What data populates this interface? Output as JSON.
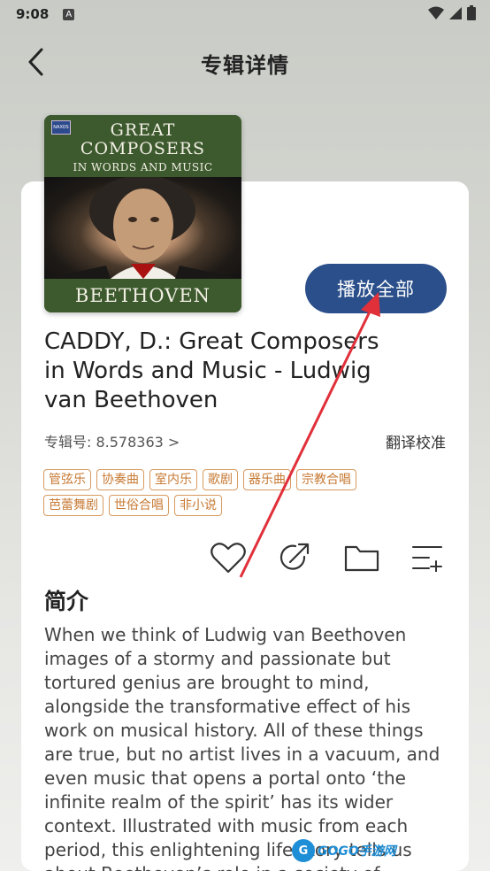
{
  "status_bar": {
    "time": "9:08",
    "notif_icon": "A"
  },
  "header": {
    "title": "专辑详情"
  },
  "cover": {
    "line1": "GREAT",
    "line2": "COMPOSERS",
    "line3": "IN WORDS AND MUSIC",
    "bottom": "BEETHOVEN",
    "label_logo": "NAXOS"
  },
  "play_all_label": "播放全部",
  "album": {
    "title": "CADDY, D.: Great Composers in Words and Music - Ludwig van Beethoven",
    "number": "专辑号:  8.578363 >",
    "translate": "翻译校准"
  },
  "tags": [
    "管弦乐",
    "协奏曲",
    "室内乐",
    "歌剧",
    "器乐曲",
    "宗教合唱",
    "芭蕾舞剧",
    "世俗合唱",
    "非小说"
  ],
  "actions": [
    "heart-icon",
    "share-icon",
    "folder-icon",
    "add-playlist-icon"
  ],
  "intro": {
    "heading": "简介",
    "text": "When we think of Ludwig van Beethoven images of a stormy and passionate but tortured genius are brought to mind, alongside the transformative effect of his work on musical history. All of these things are true, but no artist lives in a vacuum, and even music that opens a portal onto ‘the infinite realm of the spirit’ has its wider context. Illustrated with music from each period, this enlightening life story tells us about Beethoven’s role in a society of"
  },
  "watermark": {
    "logo": "G",
    "text": "GOGO手游网"
  },
  "colors": {
    "accent": "#2a4f8a",
    "tag": "#c77a34",
    "arrow": "#e0303a"
  }
}
